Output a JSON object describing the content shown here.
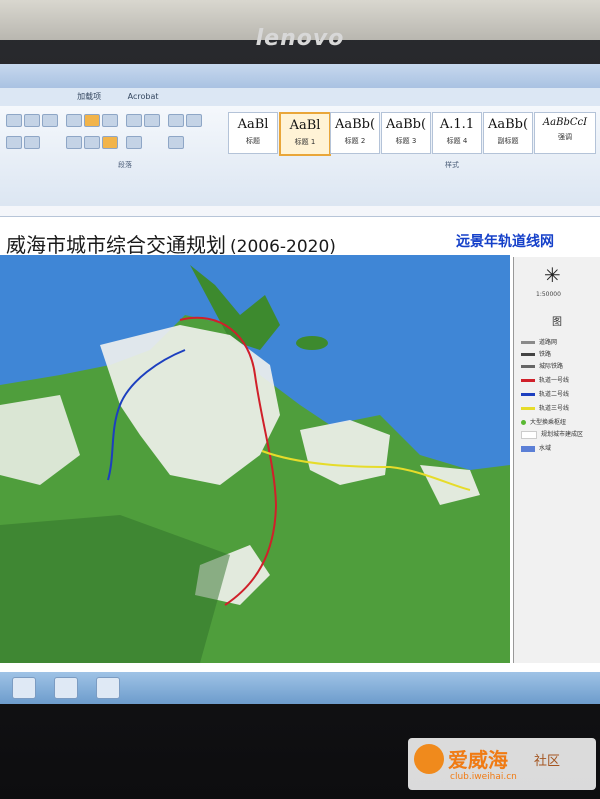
{
  "bezel": {
    "brand": "lenovo"
  },
  "window": {
    "menu": [
      "",
      "",
      "加载项",
      "Acrobat"
    ],
    "styles": [
      {
        "sample": "AaBl",
        "name": "标题"
      },
      {
        "sample": "AaBl",
        "name": "标题 1"
      },
      {
        "sample": "AaBb(",
        "name": "标题 2"
      },
      {
        "sample": "AaBb(",
        "name": "标题 3"
      },
      {
        "sample": "A.1.1",
        "name": "标题 4"
      },
      {
        "sample": "AaBb(",
        "name": "副标题"
      },
      {
        "sample": "AaBbCcI",
        "name": "强调"
      }
    ],
    "ribbon_groups": {
      "paragraph": "段落",
      "styles": "样式"
    }
  },
  "map": {
    "title": "威海市城市综合交通规划",
    "title_years": "(2006-2020)",
    "subtitle": "远景年轨道线网",
    "scale": "1:50000",
    "legend_title": "图",
    "legend": [
      {
        "label": "道路网",
        "color": "#8a8a8a"
      },
      {
        "label": "铁路",
        "color": "#444444"
      },
      {
        "label": "城际铁路",
        "color": "#666666"
      },
      {
        "label": "轨道一号线",
        "color": "#d0202a"
      },
      {
        "label": "轨道二号线",
        "color": "#1c3fbf"
      },
      {
        "label": "轨道三号线",
        "color": "#e6dc2a"
      },
      {
        "label": "大型换乘枢纽",
        "color": "#59b832"
      },
      {
        "label": "规划城市建成区",
        "color": "#f2f2f2"
      },
      {
        "label": "水域",
        "color": "#5b7fd6"
      }
    ],
    "colors": {
      "sea": "#3f86d6",
      "land": "#4f9e3c",
      "urban": "#f2f2ee",
      "line1": "#d0202a",
      "line2": "#1c3fbf",
      "line3": "#e6dc2a"
    }
  },
  "watermark": {
    "main": "爱威海",
    "sub": "社区",
    "url": "club.iweihai.cn"
  }
}
